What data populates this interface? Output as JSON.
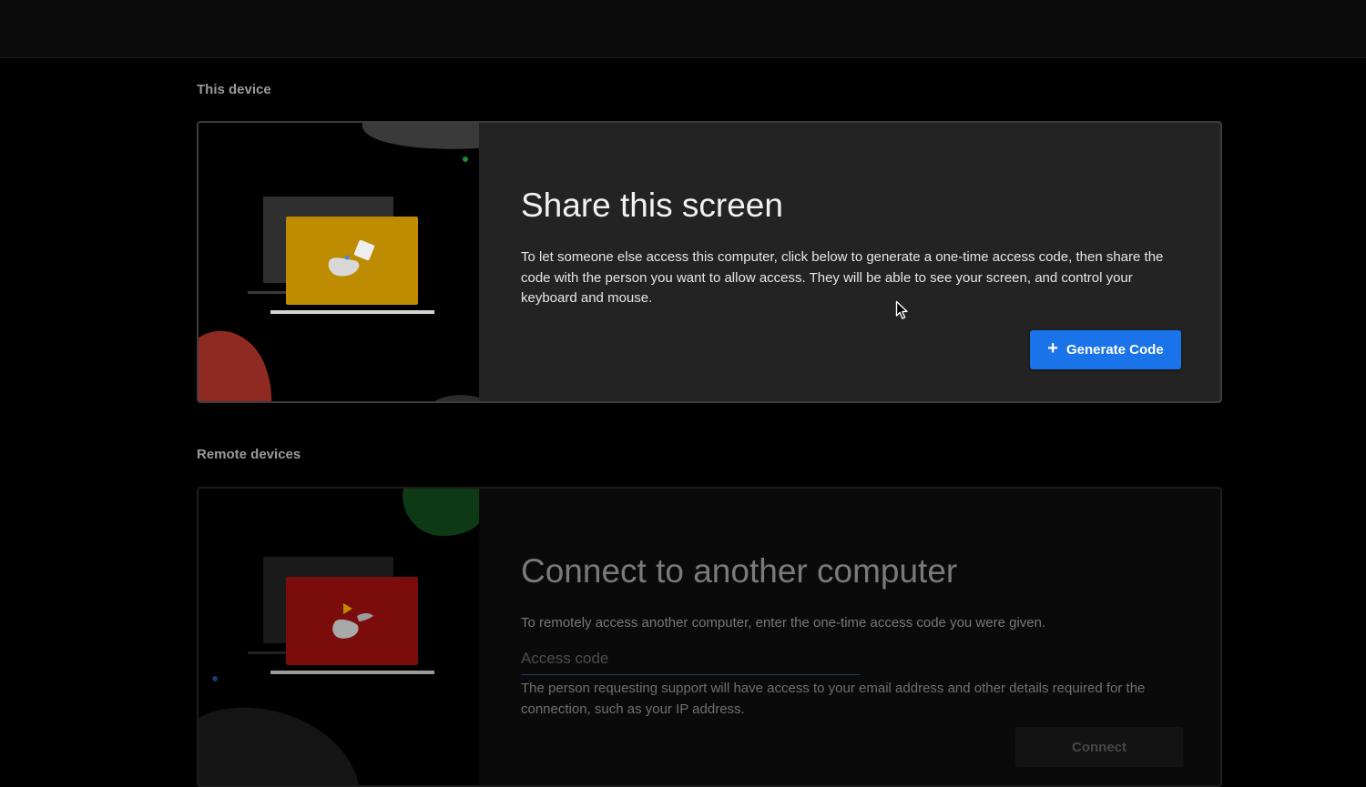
{
  "sections": {
    "this_device": "This device",
    "remote_devices": "Remote devices"
  },
  "share_card": {
    "title": "Share this screen",
    "description": "To let someone else access this computer, click below to generate a one-time access code, then share the code with the person you want to allow access. They will be able to see your screen, and control your keyboard and mouse.",
    "button_label": "Generate Code",
    "button_icon": "plus-icon"
  },
  "remote_card": {
    "title": "Connect to another computer",
    "description": "To remotely access another computer, enter the one-time access code you were given.",
    "access_code_placeholder": "Access code",
    "access_code_value": "",
    "notice": "The person requesting support will have access to your email address and other details required for the connection, such as your IP address.",
    "button_label": "Connect"
  },
  "colors": {
    "accent": "#1a73e8",
    "share_laptop_screen": "#bd8c00",
    "remote_laptop_screen": "#7a0c0c",
    "share_blob": "#8e2a22",
    "remote_blob": "#0d3a14"
  }
}
